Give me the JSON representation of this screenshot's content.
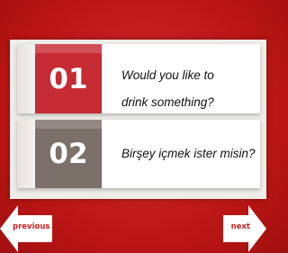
{
  "cards": [
    {
      "number": "01",
      "text_line1": "Would you like to",
      "text_line2": "drink something?"
    },
    {
      "number": "02",
      "text": "Birşey içmek ister misin?"
    }
  ],
  "nav": {
    "previous_label": "previous",
    "next_label": "next"
  },
  "colors": {
    "background": "#b81414",
    "card1_accent": "#c62a33",
    "card2_accent": "#7c706a"
  }
}
